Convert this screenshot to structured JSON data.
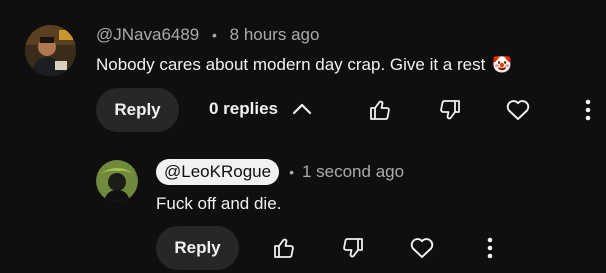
{
  "comment": {
    "author": "@JNava6489",
    "separator": "•",
    "time": "8 hours ago",
    "text": "Nobody cares about modern day crap. Give it a rest",
    "emoji": "🤡",
    "reply_label": "Reply",
    "replies_label": "0 replies",
    "icons": [
      "like-icon",
      "dislike-icon",
      "heart-icon",
      "more-vert-icon",
      "chevron-up-icon"
    ]
  },
  "reply": {
    "author": "@LeoKRogue",
    "separator": "•",
    "time": "1 second ago",
    "text": "Fuck off and die.",
    "reply_label": "Reply",
    "icons": [
      "like-icon",
      "dislike-icon",
      "heart-icon",
      "more-vert-icon"
    ]
  },
  "colors": {
    "background": "#0f0f0f",
    "text": "#f1f1f1",
    "meta": "#aaaaaa",
    "pill": "#272727"
  }
}
